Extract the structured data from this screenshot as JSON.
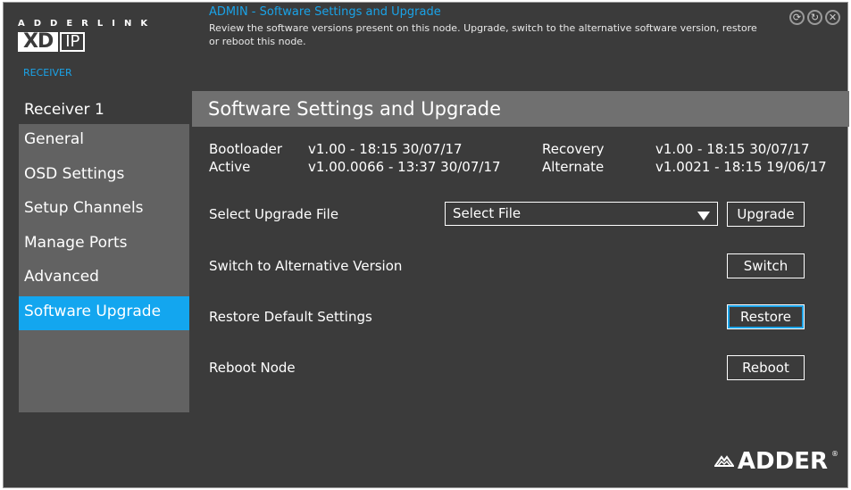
{
  "brand": {
    "line1": "ADDERLINK",
    "xd": "XD",
    "ip": "IP",
    "device_type": "RECEIVER",
    "footer_logo": "ADDER",
    "footer_logo_reg": "®"
  },
  "header": {
    "title": "ADMIN - Software Settings and Upgrade",
    "description": "Review the software versions present on this node. Upgrade, switch to the alternative software version, restore or reboot this node.",
    "icons": [
      "refresh-icon",
      "rotate-icon",
      "close-icon"
    ]
  },
  "sidebar": {
    "heading": "Receiver 1",
    "items": [
      {
        "label": "General",
        "active": false
      },
      {
        "label": "OSD Settings",
        "active": false
      },
      {
        "label": "Setup Channels",
        "active": false
      },
      {
        "label": "Manage Ports",
        "active": false
      },
      {
        "label": "Advanced",
        "active": false
      },
      {
        "label": "Software Upgrade",
        "active": true
      }
    ]
  },
  "main": {
    "section_title": "Software Settings and Upgrade",
    "versions": {
      "bootloader_label": "Bootloader",
      "bootloader_value": "v1.00 - 18:15 30/07/17",
      "recovery_label": "Recovery",
      "recovery_value": "v1.00 - 18:15 30/07/17",
      "active_label": "Active",
      "active_value": "v1.00.0066 - 13:37 30/07/17",
      "alternate_label": "Alternate",
      "alternate_value": "v1.0021 - 18:15 19/06/17"
    },
    "upgrade": {
      "label": "Select Upgrade File",
      "select_value": "Select File",
      "button": "Upgrade"
    },
    "switch": {
      "label": "Switch to Alternative Version",
      "button": "Switch"
    },
    "restore": {
      "label": "Restore Default Settings",
      "button": "Restore"
    },
    "reboot": {
      "label": "Reboot Node",
      "button": "Reboot"
    }
  },
  "colors": {
    "accent": "#13a6ef",
    "background": "#3b3b3b",
    "panel": "#626262",
    "title_bar": "#707070"
  }
}
